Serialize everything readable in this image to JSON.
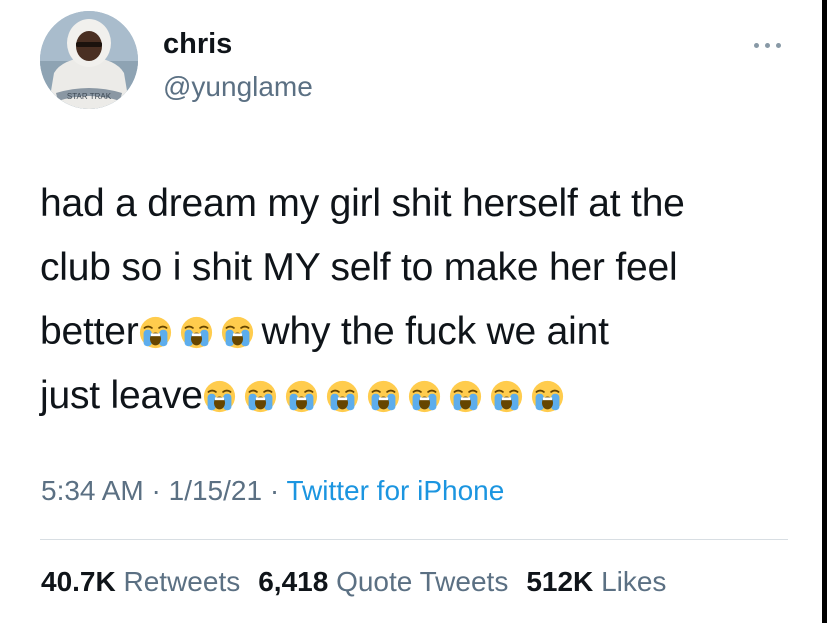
{
  "user": {
    "name": "chris",
    "handle": "@yunglame",
    "avatar_text": "STAR TRAK"
  },
  "more_icon": "more-horizontal-icon",
  "tweet": {
    "lines": [
      "had a dream my girl shit herself at the",
      "club so i shit MY self to make her feel",
      "better",
      "why the fuck we aint",
      "just leave"
    ],
    "emoji": "loudly-crying-face",
    "emoji_counts": {
      "line3": 3,
      "line4": 9
    }
  },
  "meta": {
    "time": "5:34 AM",
    "date": "1/15/21",
    "separator": "·",
    "source": "Twitter for iPhone"
  },
  "stats": {
    "retweets_count": "40.7K",
    "retweets_label": "Retweets",
    "quotes_count": "6,418",
    "quotes_label": "Quote Tweets",
    "likes_count": "512K",
    "likes_label": "Likes"
  },
  "colors": {
    "text": "#0f1419",
    "secondary": "#5b7083",
    "link": "#1b95e0",
    "divider": "#d8dee3"
  }
}
